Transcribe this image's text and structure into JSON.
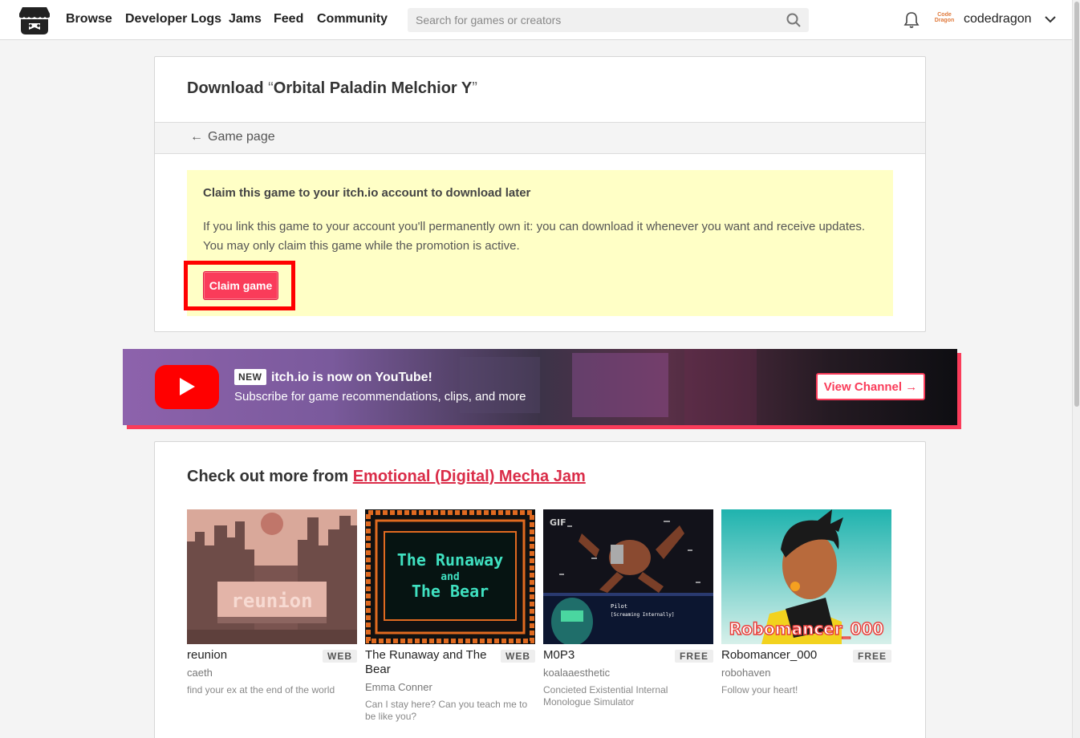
{
  "header": {
    "nav": [
      {
        "label": "Browse"
      },
      {
        "label": "Developer Logs"
      },
      {
        "label": "Jams"
      },
      {
        "label": "Feed"
      },
      {
        "label": "Community"
      }
    ],
    "search_placeholder": "Search for games or creators",
    "username": "codedragon",
    "avatar_text": "Code Dragon"
  },
  "download": {
    "title_prefix": "Download",
    "open_quote": "“",
    "game_name": "Orbital Paladin Melchior Y",
    "close_quote": "”",
    "back_link": "Game page",
    "claim_heading": "Claim this game to your itch.io account to download later",
    "claim_text": "If you link this game to your account you'll permanently own it: you can download it whenever you want and receive updates. You may only claim this game while the promotion is active.",
    "claim_button": "Claim game"
  },
  "youtube": {
    "badge": "NEW",
    "title": "itch.io is now on YouTube!",
    "subtitle": "Subscribe for game recommendations, clips, and more",
    "button": "View Channel →"
  },
  "more": {
    "heading_prefix": "Check out more from",
    "jam_link": "Emotional (Digital) Mecha Jam",
    "games": [
      {
        "title": "reunion",
        "badge": "WEB",
        "author": "caeth",
        "description": "find your ex at the end of the world",
        "thumb_text": "reunion"
      },
      {
        "title": "The Runaway and The Bear",
        "badge": "WEB",
        "author": "Emma Conner",
        "description": "Can I stay here? Can you teach me to be like you?",
        "thumb_line1": "The Runaway",
        "thumb_line2": "and",
        "thumb_line3": "The Bear"
      },
      {
        "title": "M0P3",
        "badge": "FREE",
        "author": "koalaaesthetic",
        "description": "Concieted Existential Internal Monologue Simulator",
        "thumb_gif": "GIF",
        "thumb_pilot": "Pilot",
        "thumb_caption": "[Screaming Internally]"
      },
      {
        "title": "Robomancer_000",
        "badge": "FREE",
        "author": "robohaven",
        "description": "Follow your heart!",
        "thumb_text": "Robomancer_000"
      }
    ]
  },
  "colors": {
    "accent": "#fa3c5a",
    "claim_bg": "#ffffc6",
    "highlight": "#ff0000",
    "youtube_red": "#ff0000"
  },
  "icons": [
    "itchio-logo-icon",
    "search-icon",
    "bell-icon",
    "chevron-down-icon",
    "arrow-left-icon",
    "youtube-play-icon"
  ]
}
